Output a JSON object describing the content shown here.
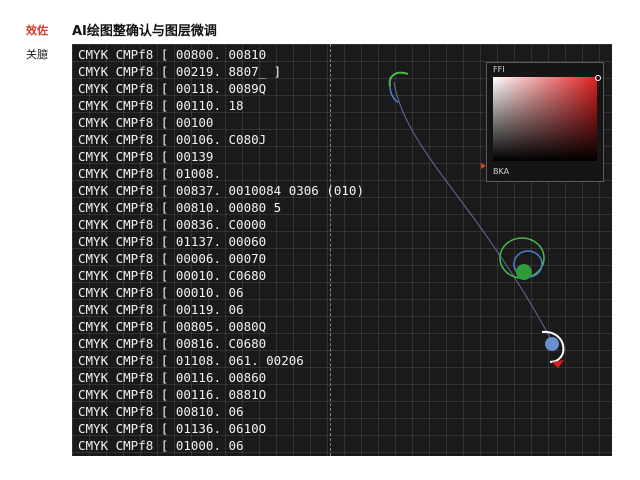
{
  "sidebar": {
    "tag_active": "效佐",
    "tag_section": "关臆"
  },
  "header": {
    "title": "AI绘图整确认与图层微调"
  },
  "canvas": {
    "lines": [
      "CMYK CMPf8 [ 00800. 00810",
      "CMYK CMPf8 [ 00219. 8807_ ]",
      "CMYK CMPf8 [ 00118. 0089Q",
      "CMYK CMPf8 [ 00110. 18",
      "CMYK CMPf8 [ 00100",
      "CMYK CMPf8 [ 00106. C080J",
      "CMYK CMPf8 [ 00139",
      "CMYK CMPf8 [ 01008.",
      "CMYK CMPf8 [ 00837. 0010084 0306 (010)",
      "CMYK CMPf8 [ 00810. 00080  5",
      "CMYK CMPf8 [ 00836. C0000",
      "CMYK CMPf8 [ 01137. 00060",
      "CMYK CMPf8 [ 00006. 00070",
      "CMYK CMPf8 [ 00010. C0680",
      "CMYK CMPf8 [ 00010. 06",
      "CMYK CMPf8 [ 00119. 06",
      "CMYK CMPf8 [ 00805. 0080Q",
      "CMYK CMPf8 [ 00816. C0680",
      "CMYK CMPf8 [ 01108. 061. 00206",
      "CMYK CMPf8 [ 00116. 00860",
      "CMYK CMPf8 [ 00116. 0881O",
      "CMYK CMPf8 [ 00810. 06",
      "CMYK CMPf8 [ 01136. 0610O",
      "CMYK CMPf8 [ 01000. 06"
    ]
  },
  "color_picker": {
    "label_top": "FFI",
    "label_bottom": "BKA",
    "hue_color": "#e02020"
  },
  "colors": {
    "canvas_bg": "#1a1a1a",
    "accent_red": "#d23a2a",
    "path_green": "#4cb84c",
    "path_blue": "#4a7fd4",
    "node_blue": "#6a8fd0"
  }
}
